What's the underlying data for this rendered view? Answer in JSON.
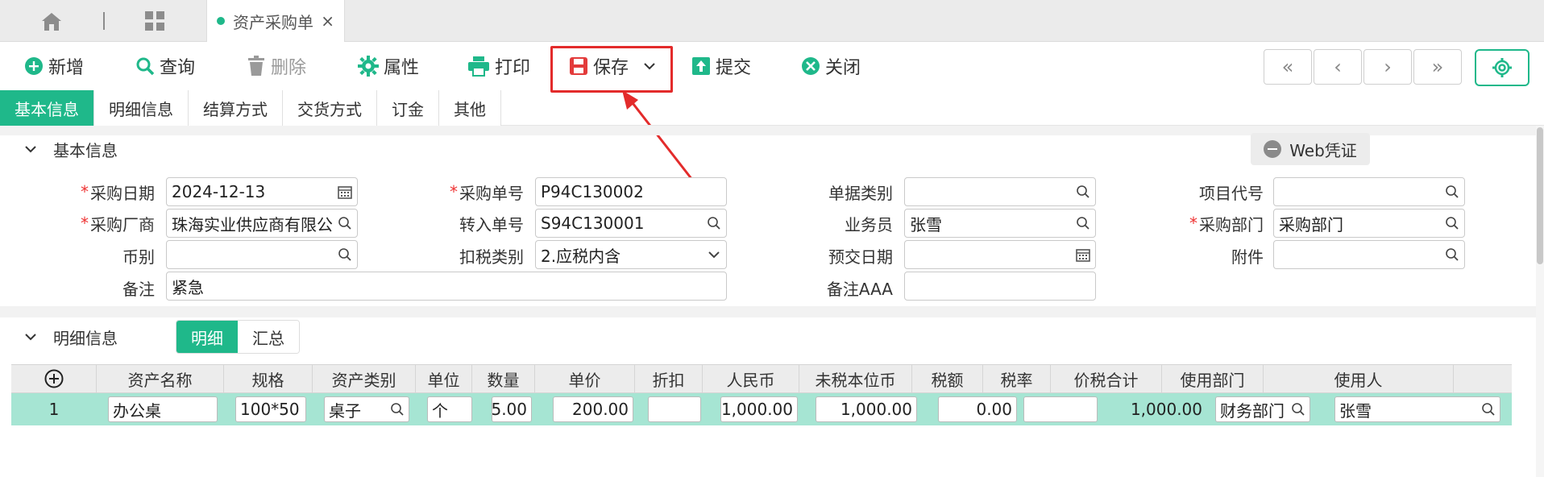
{
  "top_tabs": {
    "home_icon": "home-icon",
    "grid_icon": "grid-icon",
    "doc_tab": {
      "label": "资产采购单",
      "close": "×"
    }
  },
  "toolbar": {
    "add": "新增",
    "query": "查询",
    "delete": "删除",
    "props": "属性",
    "print": "打印",
    "save": "保存",
    "submit": "提交",
    "close": "关闭",
    "nav": [
      "«",
      "‹",
      "›",
      "»"
    ]
  },
  "section_tabs": [
    "基本信息",
    "明细信息",
    "结算方式",
    "交货方式",
    "订金",
    "其他"
  ],
  "basic": {
    "title": "基本信息",
    "web_button": "Web凭证",
    "fields": {
      "purchase_date": {
        "label": "采购日期",
        "value": "2024-12-13",
        "required": true
      },
      "purchase_no": {
        "label": "采购单号",
        "value": "P94C130002",
        "required": true
      },
      "doc_type": {
        "label": "单据类别",
        "value": ""
      },
      "project_code": {
        "label": "项目代号",
        "value": ""
      },
      "vendor": {
        "label": "采购厂商",
        "value": "珠海实业供应商有限公司",
        "required": true
      },
      "transfer_no": {
        "label": "转入单号",
        "value": "S94C130001"
      },
      "salesman": {
        "label": "业务员",
        "value": "张雪"
      },
      "dept": {
        "label": "采购部门",
        "value": "采购部门",
        "required": true
      },
      "currency": {
        "label": "币别",
        "value": ""
      },
      "tax_type": {
        "label": "扣税类别",
        "value": "2.应税内含"
      },
      "pre_date": {
        "label": "预交日期",
        "value": ""
      },
      "attachment": {
        "label": "附件",
        "value": ""
      },
      "remark": {
        "label": "备注",
        "value": "紧急"
      },
      "remark_aaa": {
        "label": "备注AAA",
        "value": ""
      }
    }
  },
  "detail": {
    "title": "明细信息",
    "subtabs": [
      "明细",
      "汇总"
    ],
    "columns": [
      "资产名称",
      "规格",
      "资产类别",
      "单位",
      "数量",
      "单价",
      "折扣",
      "人民币",
      "未税本位币",
      "税额",
      "税率",
      "价税合计",
      "使用部门",
      "使用人"
    ],
    "rows": [
      {
        "no": "1",
        "name": "办公桌",
        "spec": "100*50",
        "category": "桌子",
        "unit": "个",
        "qty": "5.00",
        "price": "200.00",
        "discount": "",
        "rmb": "1,000.00",
        "untaxed": "1,000.00",
        "tax": "0.00",
        "tax_rate": "",
        "total": "1,000.00",
        "dept": "财务部门",
        "user": "张雪"
      }
    ]
  },
  "colors": {
    "accent": "#1fb88a",
    "highlight": "#e32b2b",
    "row": "#a6e5d3"
  }
}
